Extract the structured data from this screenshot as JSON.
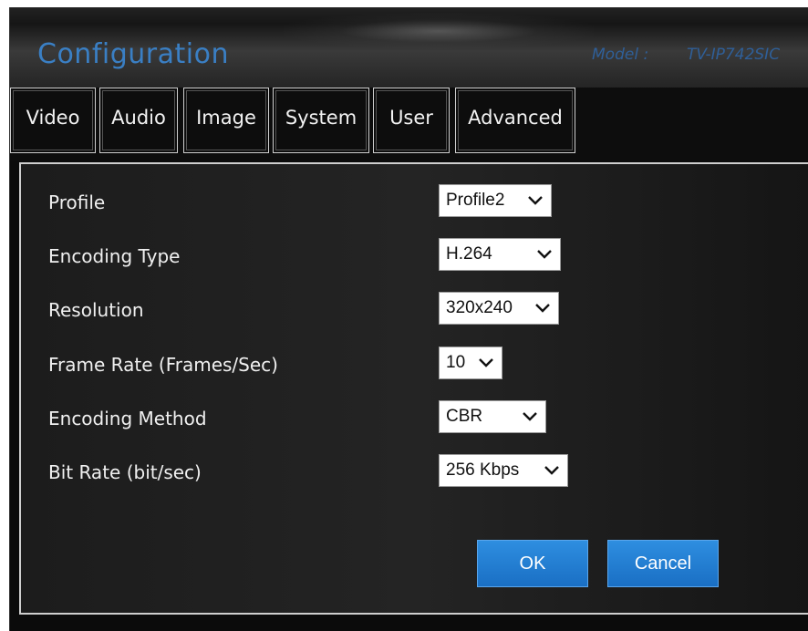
{
  "header": {
    "title": "Configuration",
    "model_label": "Model :",
    "model_value": "TV-IP742SIC"
  },
  "tabs": [
    {
      "label": "Video"
    },
    {
      "label": "Audio"
    },
    {
      "label": "Image"
    },
    {
      "label": "System"
    },
    {
      "label": "User"
    },
    {
      "label": "Advanced"
    }
  ],
  "form": {
    "rows": [
      {
        "label": "Profile",
        "value": "Profile2"
      },
      {
        "label": "Encoding Type",
        "value": "H.264"
      },
      {
        "label": "Resolution",
        "value": "320x240"
      },
      {
        "label": "Frame Rate (Frames/Sec)",
        "value": "10"
      },
      {
        "label": "Encoding Method",
        "value": "CBR"
      },
      {
        "label": "Bit Rate (bit/sec)",
        "value": "256 Kbps"
      }
    ]
  },
  "buttons": {
    "ok": "OK",
    "cancel": "Cancel"
  },
  "colors": {
    "accent": "#1a6fc4",
    "title": "#3a7fc4",
    "background": "#0b0b0b"
  }
}
